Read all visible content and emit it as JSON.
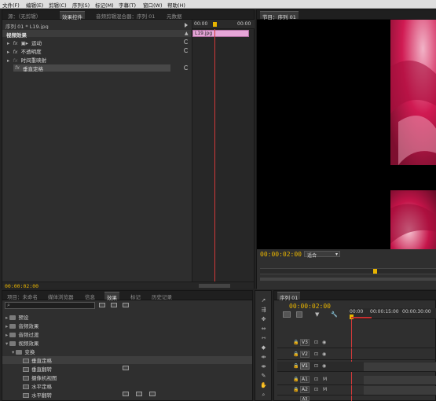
{
  "menu": [
    "文件(F)",
    "编辑(E)",
    "剪辑(C)",
    "序列(S)",
    "标记(M)",
    "字幕(T)",
    "窗口(W)",
    "帮助(H)"
  ],
  "source_panel": {
    "tabs": [
      "源：（无剪辑）",
      "效果控件",
      "音频剪辑混合器：序列 01",
      "元数据"
    ],
    "sequence_path": "序列 01 * L19.jpg",
    "timeline_start": "00:00",
    "timeline_end": "00:00",
    "clip_name": "L19.jpg",
    "header": "视频效果",
    "effects": [
      {
        "name": "运动",
        "has_reset": true
      },
      {
        "name": "不透明度",
        "has_reset": true
      },
      {
        "name": "时间重映射",
        "has_reset": false
      },
      {
        "name": "垂直定格",
        "has_reset": true
      }
    ],
    "timecode": "00:00:02:00"
  },
  "program_panel": {
    "title": "节目：序列 01",
    "timecode": "00:00:02:00",
    "zoom": "适合"
  },
  "project_panel": {
    "tabs": [
      "项目：未命名",
      "媒体浏览器",
      "信息",
      "效果",
      "标记",
      "历史记录"
    ],
    "tree": [
      {
        "label": "预设",
        "level": 0,
        "type": "folder"
      },
      {
        "label": "音频效果",
        "level": 0,
        "type": "folder"
      },
      {
        "label": "音频过渡",
        "level": 0,
        "type": "folder"
      },
      {
        "label": "视频效果",
        "level": 0,
        "type": "folder"
      },
      {
        "label": "变换",
        "level": 1,
        "type": "folder"
      },
      {
        "label": "垂直定格",
        "level": 2,
        "type": "effect"
      },
      {
        "label": "垂直翻转",
        "level": 2,
        "type": "effect"
      },
      {
        "label": "摄像机视图",
        "level": 2,
        "type": "effect"
      },
      {
        "label": "水平定格",
        "level": 2,
        "type": "effect"
      },
      {
        "label": "水平翻转",
        "level": 2,
        "type": "effect"
      }
    ]
  },
  "timeline_panel": {
    "tab": "序列 01",
    "timecode": "00:00:02:00",
    "ruler": [
      "00:00",
      "00:00:15:00",
      "00:00:30:00"
    ],
    "tracks": [
      "V3",
      "V2",
      "V1",
      "A1",
      "A2",
      "A3"
    ]
  },
  "colors": {
    "timecode": "#e8b400",
    "playhead": "#d23a3a",
    "clip": "#e6a6d8",
    "accent_rose": "#d01a52"
  }
}
